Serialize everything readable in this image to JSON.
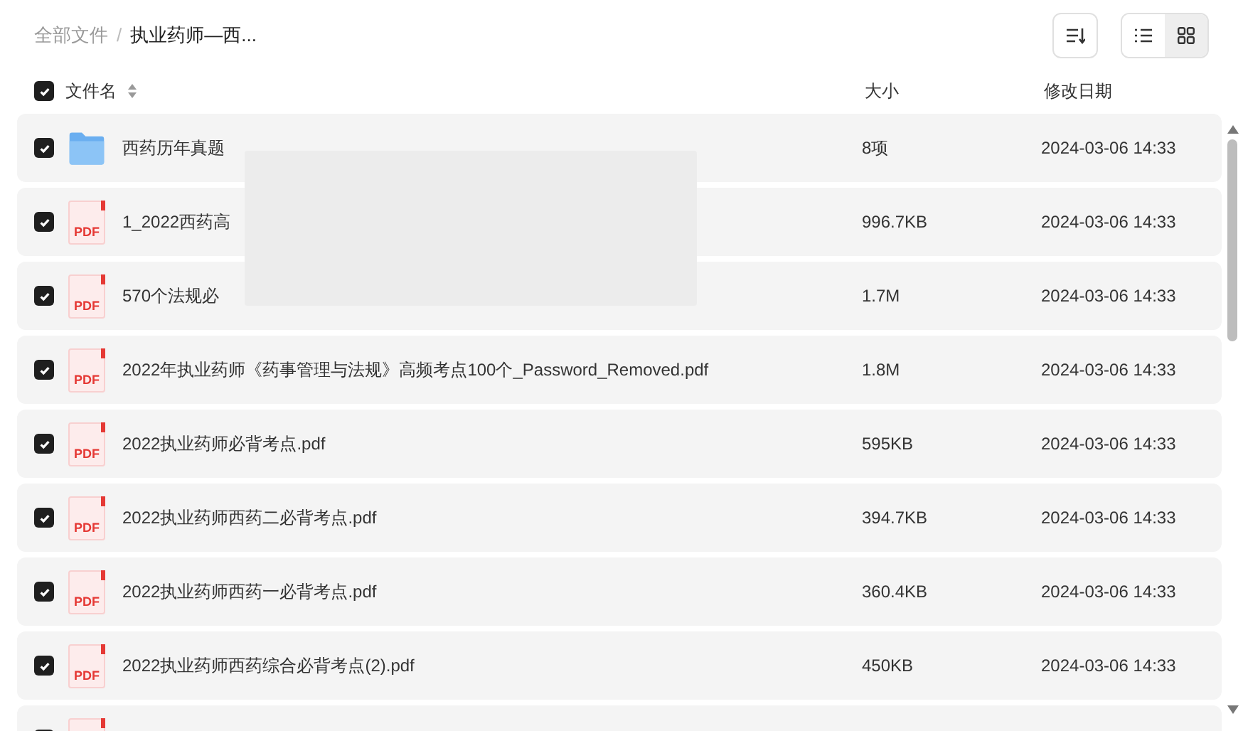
{
  "breadcrumb": [
    {
      "label": "全部文件",
      "current": false
    },
    {
      "separator": "/",
      "label": "执业药师—西...",
      "current": true
    }
  ],
  "view_modes": [
    {
      "kind": "list",
      "selected": false
    },
    {
      "kind": "grid",
      "selected": true
    }
  ],
  "columns": {
    "select_all": {
      "checked": true
    },
    "name": "文件名",
    "size": "大小",
    "date": "修改日期"
  },
  "rows": [
    {
      "kind": "folder",
      "checked": true,
      "name": "西药历年真题",
      "size": "8项",
      "date": "2024-03-06 14:33"
    },
    {
      "kind": "pdf",
      "checked": true,
      "icon_label": "PDF",
      "name": "1_2022西药高",
      "size": "996.7KB",
      "date": "2024-03-06 14:33"
    },
    {
      "kind": "pdf",
      "checked": true,
      "icon_label": "PDF",
      "name": "570个法规必",
      "size": "1.7M",
      "date": "2024-03-06 14:33"
    },
    {
      "kind": "pdf",
      "checked": true,
      "icon_label": "PDF",
      "name": "2022年执业药师《药事管理与法规》高频考点100个_Password_Removed.pdf",
      "size": "1.8M",
      "date": "2024-03-06 14:33"
    },
    {
      "kind": "pdf",
      "checked": true,
      "icon_label": "PDF",
      "name": "2022执业药师必背考点.pdf",
      "size": "595KB",
      "date": "2024-03-06 14:33"
    },
    {
      "kind": "pdf",
      "checked": true,
      "icon_label": "PDF",
      "name": "2022执业药师西药二必背考点.pdf",
      "size": "394.7KB",
      "date": "2024-03-06 14:33"
    },
    {
      "kind": "pdf",
      "checked": true,
      "icon_label": "PDF",
      "name": "2022执业药师西药一必背考点.pdf",
      "size": "360.4KB",
      "date": "2024-03-06 14:33"
    },
    {
      "kind": "pdf",
      "checked": true,
      "icon_label": "PDF",
      "name": "2022执业药师西药综合必背考点(2).pdf",
      "size": "450KB",
      "date": "2024-03-06 14:33"
    },
    {
      "kind": "pdf",
      "checked": true
    }
  ]
}
